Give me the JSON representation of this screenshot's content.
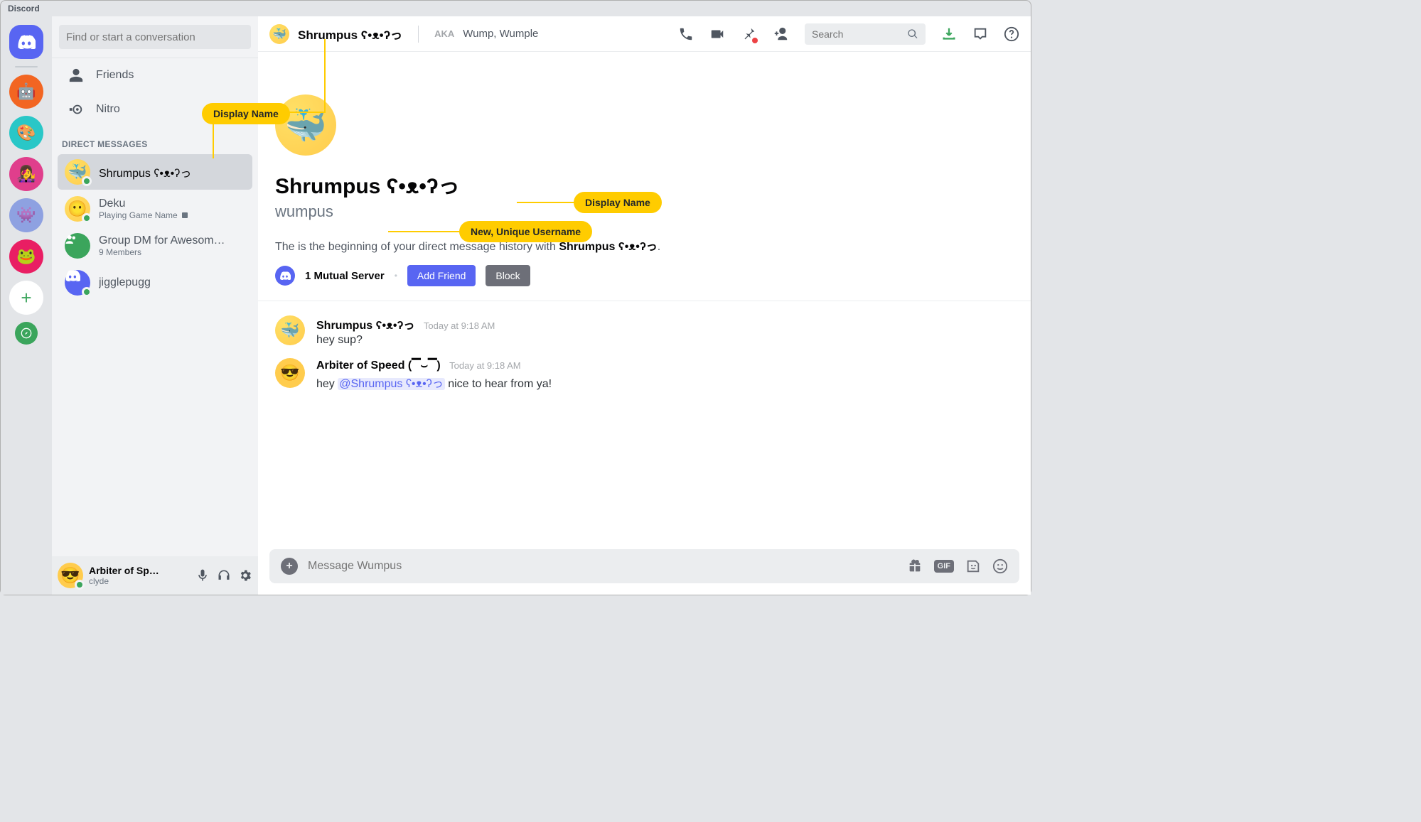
{
  "app": {
    "title": "Discord"
  },
  "dm_panel": {
    "search_placeholder": "Find or start a conversation",
    "nav": {
      "friends": "Friends",
      "nitro": "Nitro"
    },
    "section_header": "DIRECT MESSAGES",
    "items": [
      {
        "name": "Shrumpus ʕ•ᴥ•ʔっ",
        "sub": "",
        "active": true
      },
      {
        "name": "Deku",
        "sub": "Playing Game Name",
        "has_richpresence": true
      },
      {
        "name": "Group DM for Awesom…",
        "sub": "9 Members",
        "group": true
      },
      {
        "name": "jigglepugg",
        "sub": ""
      }
    ]
  },
  "user_footer": {
    "display_name": "Arbiter of Sp…",
    "username": "clyde"
  },
  "chat": {
    "header_name": "Shrumpus ʕ•ᴥ•ʔっ",
    "aka_label": "AKA",
    "aka_value": "Wump, Wumple",
    "search_placeholder": "Search",
    "profile": {
      "display_name": "Shrumpus ʕ•ᴥ•ʔっ",
      "username": "wumpus",
      "intro_prefix": "The is the beginning of your direct message history with ",
      "intro_name": "Shrumpus ʕ•ᴥ•ʔっ",
      "intro_suffix": ".",
      "mutual_servers": "1 Mutual Server",
      "add_friend": "Add Friend",
      "block": "Block"
    },
    "messages": [
      {
        "author": "Shrumpus ʕ•ᴥ•ʔっ",
        "timestamp": "Today at 9:18 AM",
        "body_pre": "hey sup?",
        "mention": "",
        "body_post": ""
      },
      {
        "author": "Arbiter of Speed (▔⌣▔)",
        "timestamp": "Today at 9:18 AM",
        "body_pre": "hey ",
        "mention": "@Shrumpus ʕ•ᴥ•ʔっ",
        "body_post": " nice to hear from ya!"
      }
    ],
    "composer_placeholder": "Message Wumpus"
  },
  "callouts": {
    "display_name_top": "Display Name",
    "display_name_profile": "Display Name",
    "username_profile": "New, Unique Username"
  }
}
